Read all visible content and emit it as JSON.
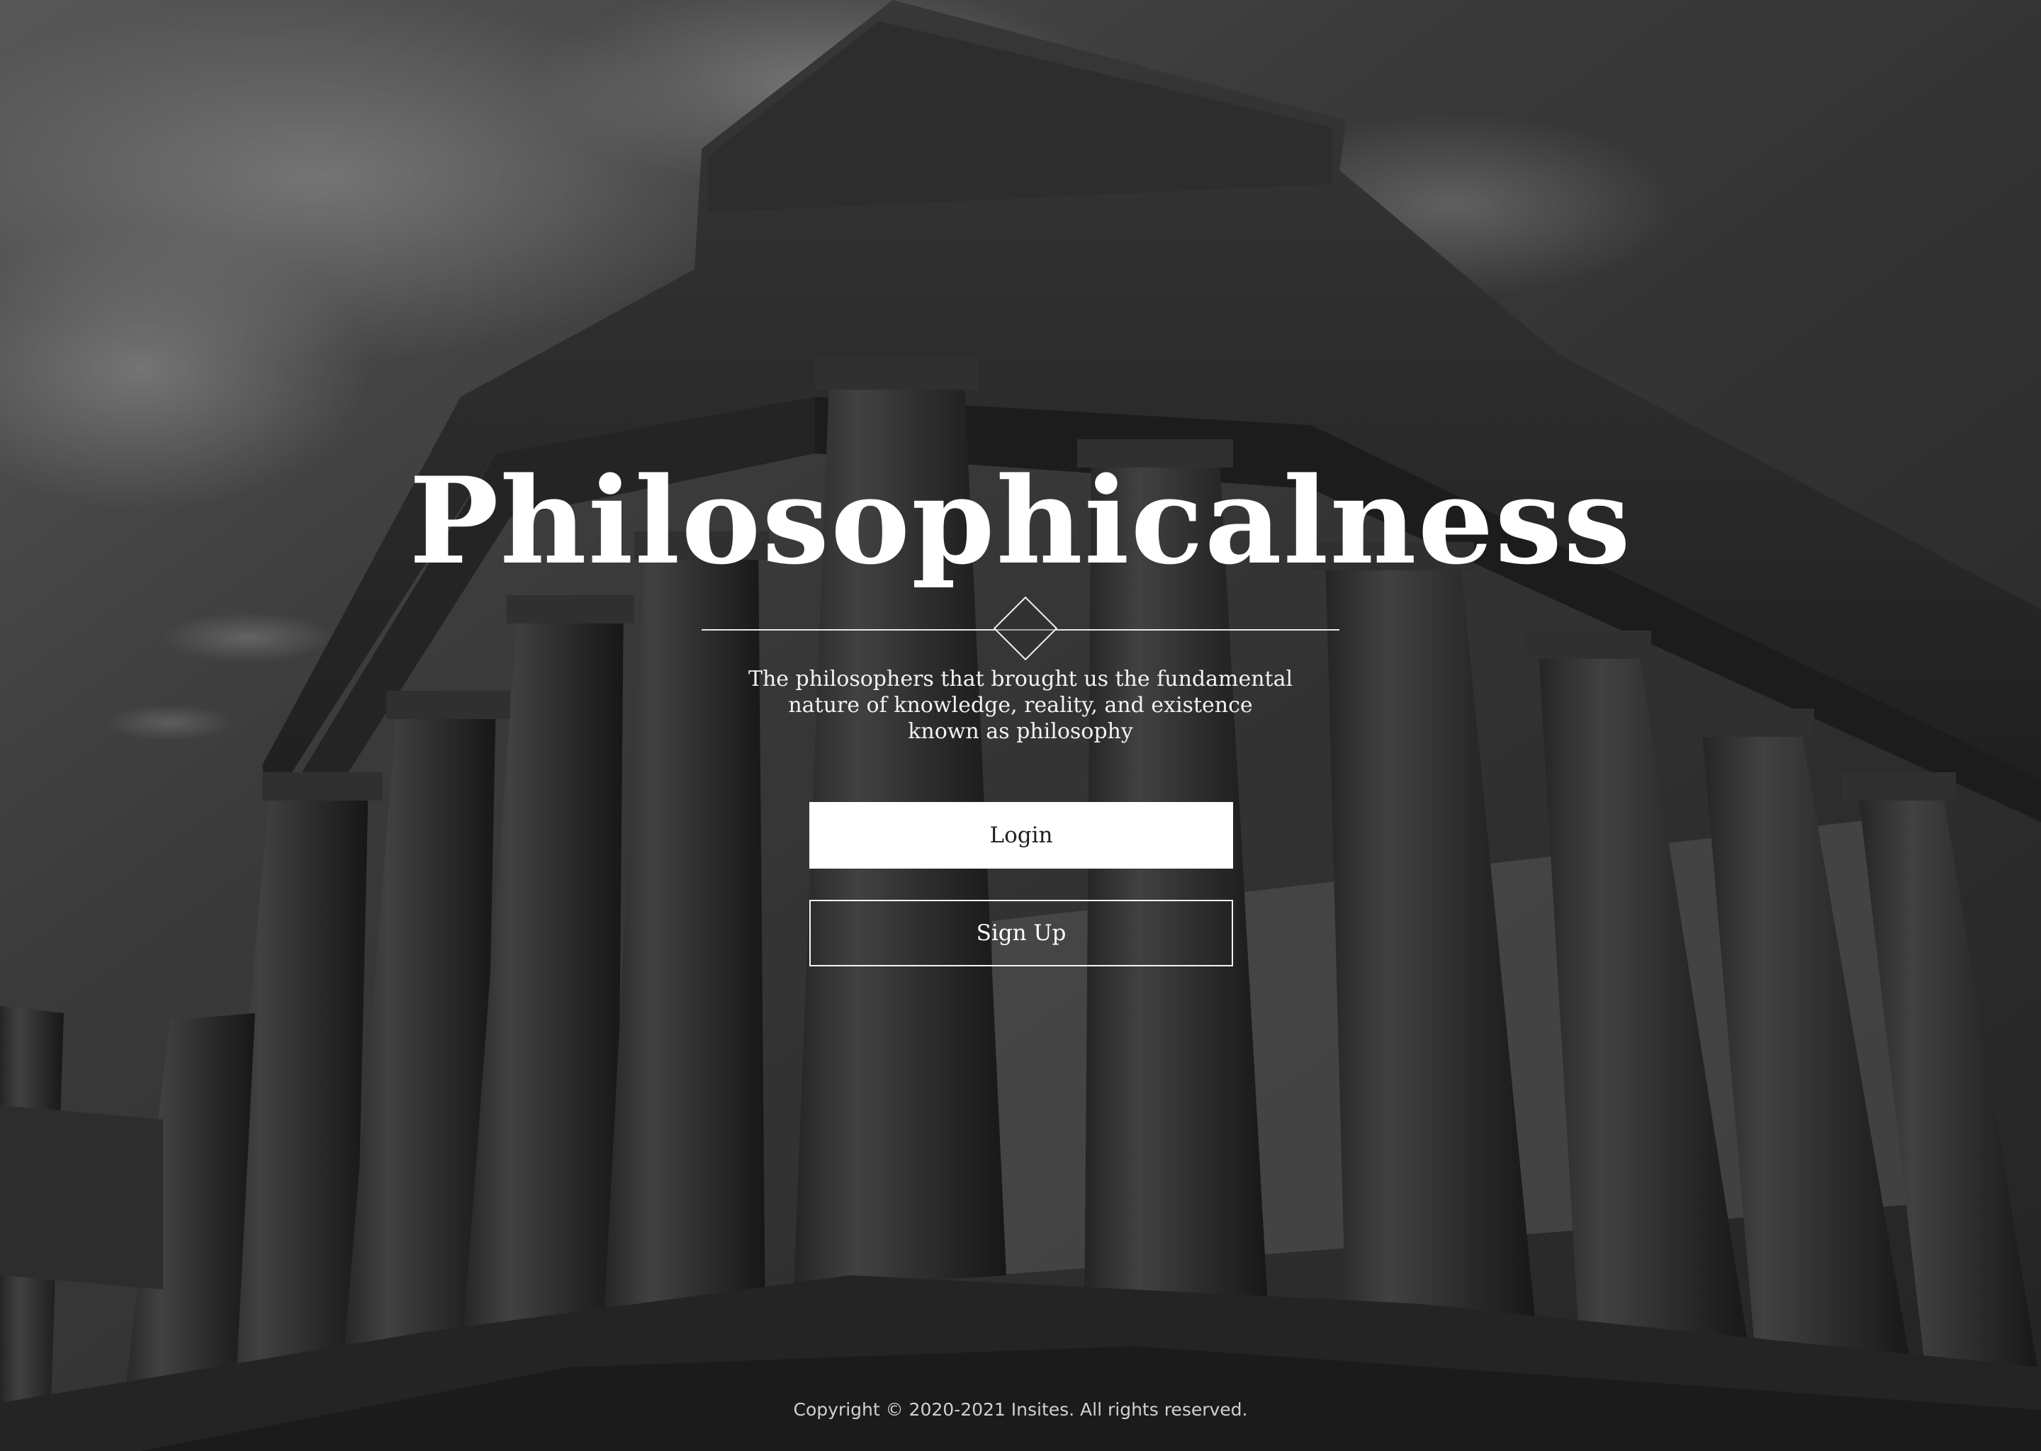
{
  "hero": {
    "title": "Philosophicalness",
    "subtitle_lines": [
      "The philosophers that brought us the fundamental",
      "nature of knowledge, reality, and existence",
      "known as philosophy"
    ]
  },
  "actions": {
    "login_label": "Login",
    "signup_label": "Sign Up"
  },
  "footer": {
    "copyright": "Copyright © 2020-2021 Insites. All rights reserved."
  },
  "colors": {
    "text": "#ffffff",
    "login_bg": "#ffffff",
    "login_text": "#222222",
    "overlay": "#000000"
  }
}
